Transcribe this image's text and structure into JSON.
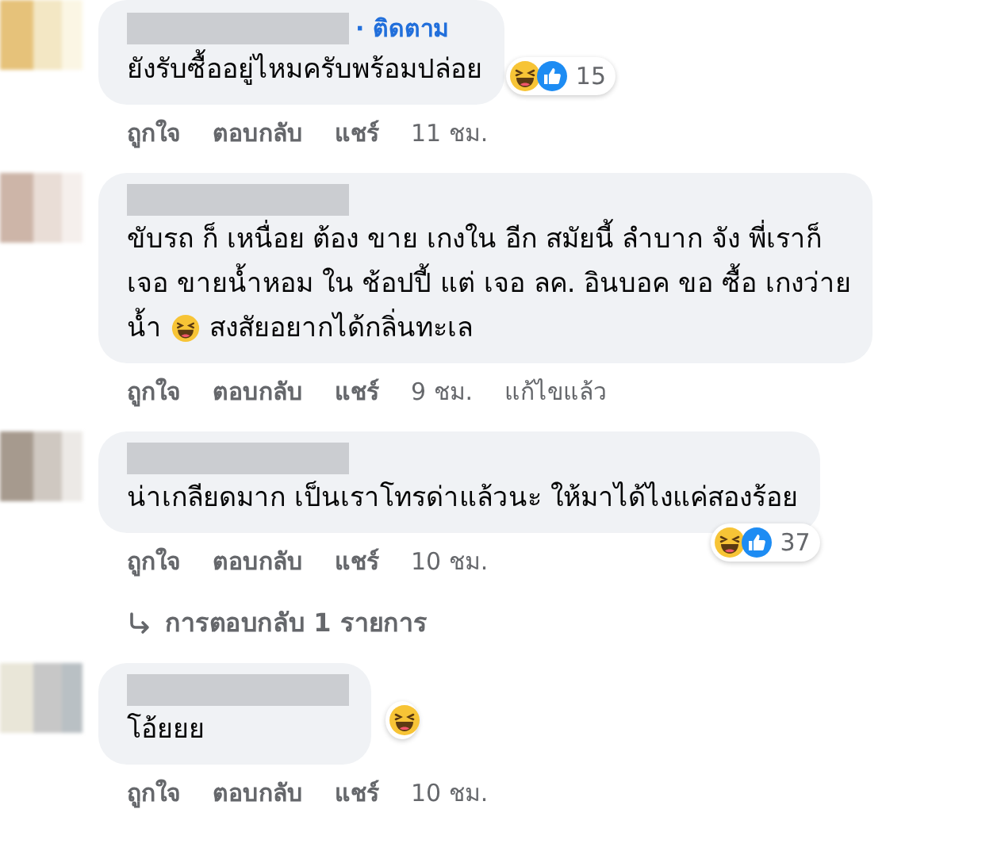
{
  "comments": [
    {
      "name_hidden": true,
      "follow_link": "· ติดตาม",
      "lines": [
        [
          {
            "kind": "text",
            "text": "ยังรับซื้ออยู่ไหมครับพร้อมปล่อย"
          }
        ]
      ],
      "reactions": {
        "kind": "side",
        "icons": [
          {
            "kind": "haha"
          },
          {
            "kind": "like"
          }
        ],
        "count": "15"
      },
      "actions": [
        "ถูกใจ",
        "ตอบกลับ",
        "แชร์"
      ],
      "time": "11 ชม."
    },
    {
      "name_hidden": true,
      "lines": [
        [
          {
            "kind": "text",
            "text": "ขับรถ ก็ เหนื่อย ต้อง ขาย เกงใน อีก สมัยนี้ ลำบาก จัง พี่เราก็"
          }
        ],
        [
          {
            "kind": "text",
            "text": "เจอ ขายน้ำหอม ใน ช้อปปี้ แต่ เจอ ลค. อินบอค ขอ ซื้อ เกงว่าย"
          }
        ],
        [
          {
            "kind": "text",
            "text": "น้ำ"
          },
          {
            "kind": "haha"
          },
          {
            "kind": "text",
            "text": "สงสัยอยากได้กลิ่นทะเล"
          }
        ]
      ],
      "actions": [
        "ถูกใจ",
        "ตอบกลับ",
        "แชร์"
      ],
      "time": "9 ชม.",
      "edited": "แก้ไขแล้ว"
    },
    {
      "name_hidden": true,
      "lines": [
        [
          {
            "kind": "text",
            "text": "น่าเกลียดมาก เป็นเราโทรด่าแล้วนะ ให้มาได้ไงแค่สองร้อย"
          }
        ]
      ],
      "reactions": {
        "kind": "below",
        "icons": [
          {
            "kind": "haha"
          },
          {
            "kind": "like"
          }
        ],
        "count": "37"
      },
      "actions": [
        "ถูกใจ",
        "ตอบกลับ",
        "แชร์"
      ],
      "time": "10 ชม.",
      "replies_link": "การตอบกลับ 1 รายการ"
    },
    {
      "name_hidden": true,
      "lines": [
        [
          {
            "kind": "text",
            "text": "โอ้ยยย"
          }
        ]
      ],
      "reactions": {
        "kind": "corner",
        "icons": [
          {
            "kind": "haha"
          }
        ]
      },
      "actions": [
        "ถูกใจ",
        "ตอบกลับ",
        "แชร์"
      ],
      "time": "10 ชม."
    }
  ]
}
